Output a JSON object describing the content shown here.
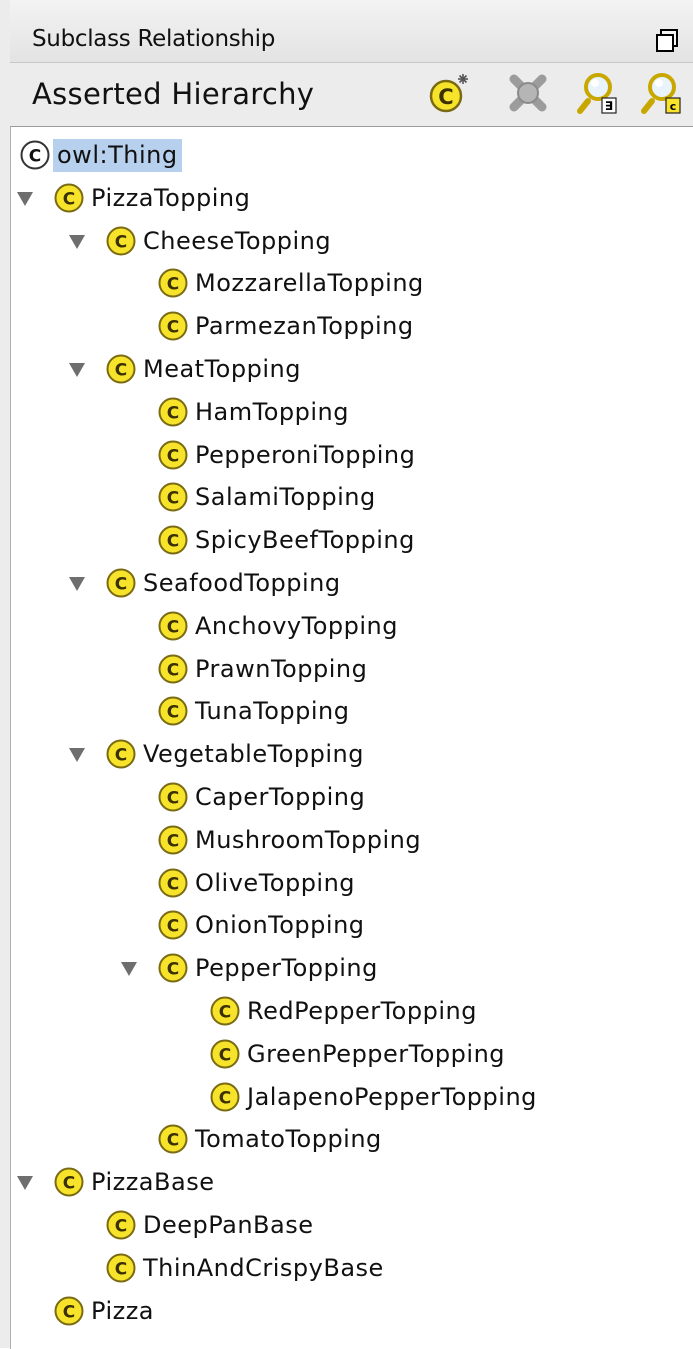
{
  "panel": {
    "title": "Subclass Relationship",
    "header": "Asserted Hierarchy",
    "toolbar": [
      {
        "name": "create-subclass",
        "icon": "add-class-icon"
      },
      {
        "name": "delete-class",
        "icon": "delete-class-icon"
      },
      {
        "name": "find-restriction",
        "icon": "find-exists-icon"
      },
      {
        "name": "find-class",
        "icon": "find-class-icon"
      }
    ]
  },
  "tree": [
    {
      "label": "owl:Thing",
      "depth": 0,
      "expanded": null,
      "selected": true,
      "root": true
    },
    {
      "label": "PizzaTopping",
      "depth": 1,
      "expanded": true
    },
    {
      "label": "CheeseTopping",
      "depth": 2,
      "expanded": true
    },
    {
      "label": "MozzarellaTopping",
      "depth": 3
    },
    {
      "label": "ParmezanTopping",
      "depth": 3
    },
    {
      "label": "MeatTopping",
      "depth": 2,
      "expanded": true
    },
    {
      "label": "HamTopping",
      "depth": 3
    },
    {
      "label": "PepperoniTopping",
      "depth": 3
    },
    {
      "label": "SalamiTopping",
      "depth": 3
    },
    {
      "label": "SpicyBeefTopping",
      "depth": 3
    },
    {
      "label": "SeafoodTopping",
      "depth": 2,
      "expanded": true
    },
    {
      "label": "AnchovyTopping",
      "depth": 3
    },
    {
      "label": "PrawnTopping",
      "depth": 3
    },
    {
      "label": "TunaTopping",
      "depth": 3
    },
    {
      "label": "VegetableTopping",
      "depth": 2,
      "expanded": true
    },
    {
      "label": "CaperTopping",
      "depth": 3
    },
    {
      "label": "MushroomTopping",
      "depth": 3
    },
    {
      "label": "OliveTopping",
      "depth": 3
    },
    {
      "label": "OnionTopping",
      "depth": 3
    },
    {
      "label": "PepperTopping",
      "depth": 3,
      "expanded": true
    },
    {
      "label": "RedPepperTopping",
      "depth": 4
    },
    {
      "label": "GreenPepperTopping",
      "depth": 4
    },
    {
      "label": "JalapenoPepperTopping",
      "depth": 4
    },
    {
      "label": "TomatoTopping",
      "depth": 3
    },
    {
      "label": "PizzaBase",
      "depth": 1,
      "expanded": true
    },
    {
      "label": "DeepPanBase",
      "depth": 2
    },
    {
      "label": "ThinAndCrispyBase",
      "depth": 2
    },
    {
      "label": "Pizza",
      "depth": 1
    }
  ],
  "colors": {
    "class_icon_fill": "#f7e32a",
    "class_icon_border": "#7a6a12",
    "root_icon_fill": "#ffffff",
    "selection": "#b7d0ee"
  }
}
